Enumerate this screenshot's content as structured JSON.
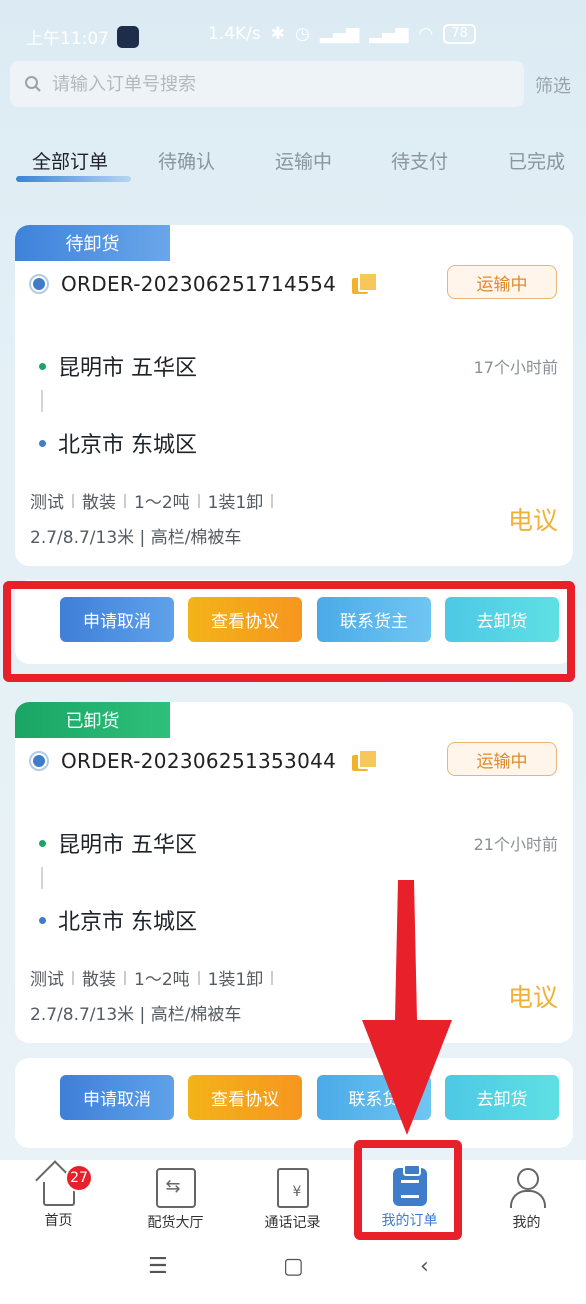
{
  "status_bar": {
    "time": "上午11:07",
    "net_speed": "1.4K/s",
    "battery": "78"
  },
  "search": {
    "placeholder": "请输入订单号搜索",
    "filter_label": "筛选"
  },
  "tabs": [
    {
      "label": "全部订单",
      "active": true
    },
    {
      "label": "待确认",
      "active": false
    },
    {
      "label": "运输中",
      "active": false
    },
    {
      "label": "待支付",
      "active": false
    },
    {
      "label": "已完成",
      "active": false
    }
  ],
  "orders": [
    {
      "badge": "待卸货",
      "badge_color": "#3e82da",
      "order_no": "ORDER-202306251714554",
      "status": "运输中",
      "origin": "昆明市 五华区",
      "destination": "北京市 东城区",
      "time_ago": "17个小时前",
      "specs": [
        "测试",
        "散装",
        "1～2吨",
        "1装1卸"
      ],
      "specs_line2": "2.7/8.7/13米 | 高栏/棉被车",
      "price": "电议"
    },
    {
      "badge": "已卸货",
      "badge_color": "#1aa565",
      "order_no": "ORDER-202306251353044",
      "status": "运输中",
      "origin": "昆明市 五华区",
      "destination": "北京市 东城区",
      "time_ago": "21个小时前",
      "specs": [
        "测试",
        "散装",
        "1～2吨",
        "1装1卸"
      ],
      "specs_line2": "2.7/8.7/13米 | 高栏/棉被车",
      "price": "电议"
    }
  ],
  "actions": {
    "cancel": "申请取消",
    "agreement": "查看协议",
    "contact": "联系货主",
    "unload": "去卸货"
  },
  "actions_partial": {
    "contact": "联系货"
  },
  "bottom_nav": [
    {
      "label": "首页",
      "icon": "home-icon",
      "badge": "27"
    },
    {
      "label": "配货大厅",
      "icon": "cargo-hall-icon"
    },
    {
      "label": "通话记录",
      "icon": "call-record-icon"
    },
    {
      "label": "我的订单",
      "icon": "my-orders-icon",
      "active": true
    },
    {
      "label": "我的",
      "icon": "profile-icon"
    }
  ],
  "colors": {
    "accent": "#3f7cc9",
    "highlight": "#e8202a",
    "price": "#f0b236"
  }
}
